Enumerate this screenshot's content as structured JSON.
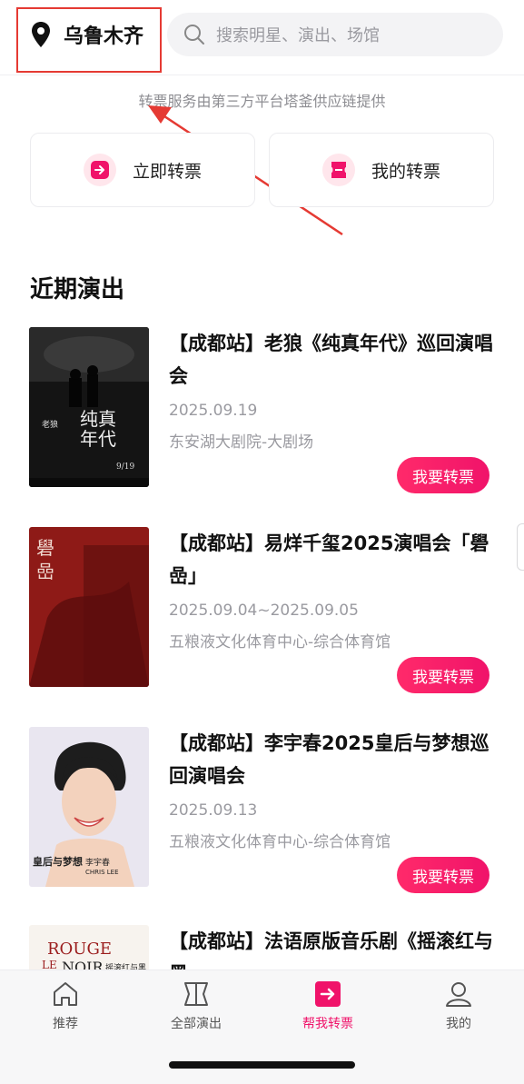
{
  "header": {
    "city": "乌鲁木齐",
    "search_placeholder": "搜索明星、演出、场馆"
  },
  "notice": "转票服务由第三方平台塔釜供应链提供",
  "actions": [
    {
      "label": "立即转票",
      "icon": "arrow-right-icon"
    },
    {
      "label": "我的转票",
      "icon": "ticket-icon"
    }
  ],
  "section_title": "近期演出",
  "shows": [
    {
      "title": "【成都站】老狼《纯真年代》巡回演唱会",
      "date": "2025.09.19",
      "venue": "东安湖大剧院-大剧场",
      "button": "我要转票",
      "poster_text": [
        "老狼",
        "纯真",
        "年代",
        "9/19"
      ]
    },
    {
      "title": "【成都站】易烊千玺2025演唱会「礐嵒」",
      "date": "2025.09.04~2025.09.05",
      "venue": "五粮液文化体育中心-综合体育馆",
      "button": "我要转票",
      "poster_text": [
        "礐",
        "嵒"
      ]
    },
    {
      "title": "【成都站】李宇春2025皇后与梦想巡回演唱会",
      "date": "2025.09.13",
      "venue": "五粮液文化体育中心-综合体育馆",
      "button": "我要转票",
      "poster_text": [
        "皇后与梦想",
        "李宇春",
        "CHRIS LEE"
      ]
    },
    {
      "title": "【成都站】法语原版音乐剧《摇滚红与黑",
      "poster_text": [
        "ROUGE",
        "LE",
        "NOIR",
        "摇滚红与黑"
      ]
    }
  ],
  "nav": [
    {
      "label": "推荐",
      "icon": "home-icon",
      "active": false
    },
    {
      "label": "全部演出",
      "icon": "shows-icon",
      "active": false
    },
    {
      "label": "帮我转票",
      "icon": "resell-icon",
      "active": true
    },
    {
      "label": "我的",
      "icon": "profile-icon",
      "active": false
    }
  ],
  "colors": {
    "accent": "#f0136a",
    "annotation": "#e53a33",
    "muted_text": "#9a9aa0"
  }
}
